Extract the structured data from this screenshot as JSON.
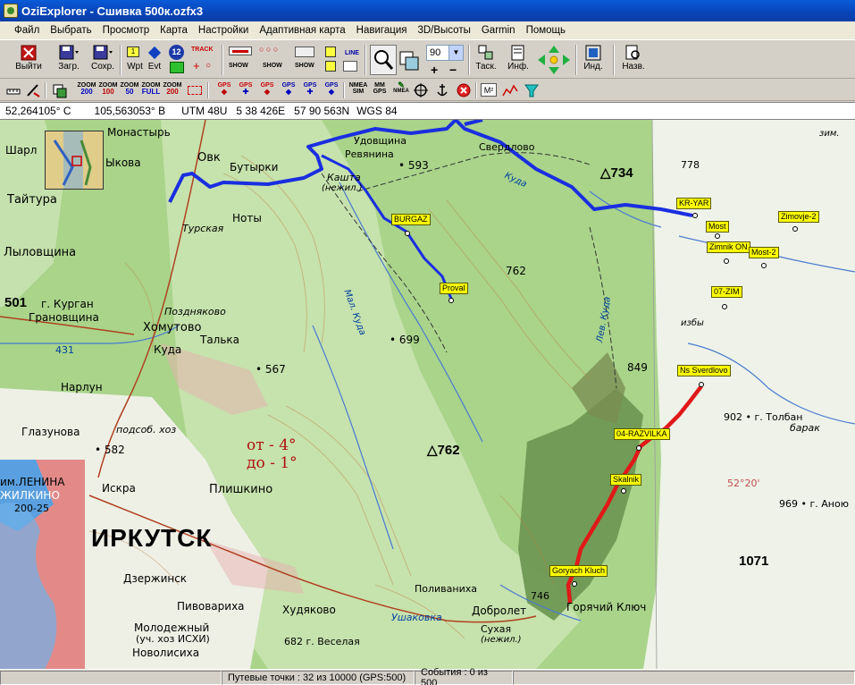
{
  "window": {
    "title": "OziExplorer - Сшивка 500к.ozfx3"
  },
  "menu": [
    "Файл",
    "Выбрать",
    "Просмотр",
    "Карта",
    "Настройки",
    "Адаптивная карта",
    "Навигация",
    "3D/Высоты",
    "Garmin",
    "Помощь"
  ],
  "toolbar": {
    "exit": "Выйти",
    "load": "Загр.",
    "save": "Сохр.",
    "wpt": "Wpt",
    "evt": "Evt",
    "badge12": "12",
    "track": "TRACK",
    "show1": "SHOW",
    "show2": "SHOW",
    "show3": "SHOW",
    "line": "LINE",
    "zoom_value": "90",
    "drag": "Таск.",
    "info": "Инф.",
    "ind": "Инд.",
    "name": "Назв."
  },
  "toolbar2": {
    "zooms": [
      {
        "top": "ZOOM",
        "val": "200",
        "color": "blue"
      },
      {
        "top": "ZOOM",
        "val": "100",
        "color": "red"
      },
      {
        "top": "ZOOM",
        "val": "50",
        "color": "blue"
      },
      {
        "top": "ZOOM",
        "val": "FULL",
        "color": "blue"
      },
      {
        "top": "ZOOM",
        "val": "200",
        "color": "red"
      }
    ],
    "gps": [
      "GPS",
      "GPS",
      "GPS",
      "GPS",
      "GPS",
      "GPS"
    ],
    "nmea_sim_top": "NMEA",
    "nmea_sim_bot": "SIM",
    "mm_top": "MM",
    "mm_bot": "GPS",
    "nmea2": "NMEA",
    "m2": "M²"
  },
  "coords": {
    "lat": "52,264105° C",
    "lon": "105,563053° В",
    "utm": "UTM  48U",
    "east": "5 38 426E",
    "north": "57 90 563N",
    "datum": "WGS 84"
  },
  "map": {
    "waypoints": [
      {
        "name": "BURGAZ"
      },
      {
        "name": "Proval"
      },
      {
        "name": "KR-YAR"
      },
      {
        "name": "Most"
      },
      {
        "name": "Zimnik ON"
      },
      {
        "name": "Most-2"
      },
      {
        "name": "Zimovje-2"
      },
      {
        "name": "07-ZIM"
      },
      {
        "name": "Ns Sverdlovo"
      },
      {
        "name": "04-RAZVILKA"
      },
      {
        "name": "Skalnik"
      },
      {
        "name": "Goryach Kluch"
      }
    ],
    "places": {
      "udovshina": "Удовщина",
      "revyanina": "Ревянина",
      "sverdlovo": "Свердлово",
      "kaishta": "Кашта",
      "nezhil1": "(нежил.)",
      "obk": "Овк",
      "butyrki": "Бутырки",
      "noty": "Ноты",
      "monastyr": "Монастырь",
      "sharl": "Шарл",
      "ykovo": "Ыкова",
      "taitura": "Тайтура",
      "tureskaya": "Турская",
      "lylovshina": "Лыловщина",
      "kurgan": "г. Курган",
      "granovshina": "Грановщина",
      "pozdnyakovo": "Поздняково",
      "khomutovo": "Хомутово",
      "talka": "Талька",
      "kuda": "Куда",
      "narlun": "Нарлун",
      "glazunova": "Глазунова",
      "podsob": "подсоб. хоз",
      "iskra": "Искра",
      "plishkino": "Плишкино",
      "lenina": "им.ЛЕНИНА",
      "zhilkino": "ЖИЛКИНО",
      "irkutsk": "ИРКУТСК",
      "dzerzhinsk": "Дзержинск",
      "pivovarikha": "Пивовариха",
      "khudyakovo": "Худяково",
      "molodezhny": "Молодежный",
      "uch_kh": "(уч. хоз ИСХИ)",
      "novolisikha": "Новолисиха",
      "veselaya": "682 г. Веселая",
      "polivanikha": "Поливаниха",
      "dobrolet": "Добролет",
      "ushakovka": "Ушаковка",
      "sukhaya": "Сухая",
      "nezhil2": "(нежил.)",
      "goryachiy": "Горячий Ключ",
      "tolban": "902 • г. Толбан",
      "barak": "барак",
      "anyu": "969 • г. Аною",
      "zim": "зим.",
      "izby": "избы",
      "mal_kuda": "Мал. Куда",
      "lev_kuda": "Лев. Куда",
      "kuda_river": "Куда"
    },
    "elevations": {
      "e593": "• 593",
      "e734": "△734",
      "e762a": "762",
      "e699": "• 699",
      "e567": "• 567",
      "e849": "849",
      "e762b": "△762",
      "e582": "• 582",
      "e501": "501",
      "e431": "431",
      "e746": "746",
      "e778": "778",
      "e1071": "1071",
      "e52_20": "52°20'"
    },
    "decl_line1": "от - 4°",
    "decl_line2": "до - 1°",
    "road_label": "200-25"
  },
  "status": {
    "waypoints": "Путевые точки : 32 из 10000  (GPS:500)",
    "events": "События : 0 из 500"
  }
}
